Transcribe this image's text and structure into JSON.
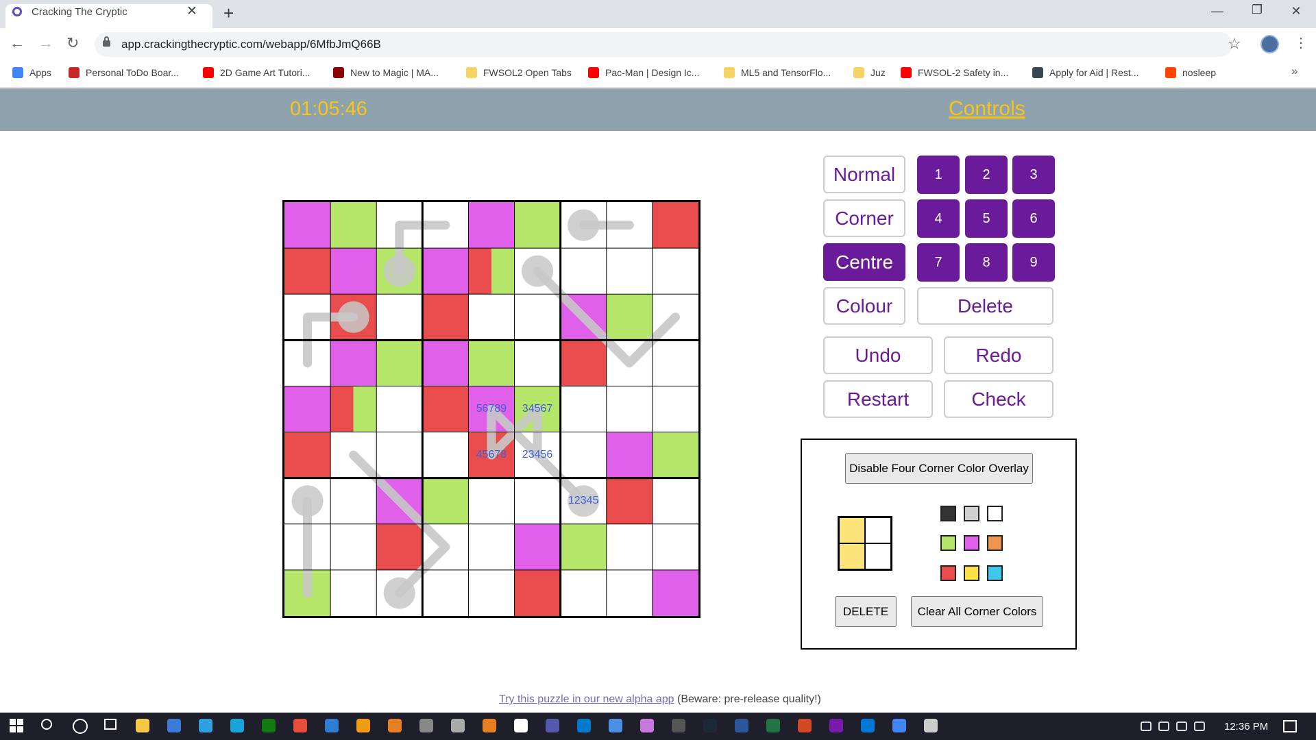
{
  "browser": {
    "tab_title": "Cracking The Cryptic",
    "url": "app.crackingthecryptic.com/webapp/6MfbJmQ66B",
    "bookmarks": [
      {
        "label": "Apps",
        "color": "#4285f4"
      },
      {
        "label": "Personal ToDo Boar...",
        "color": "#c62828"
      },
      {
        "label": "2D Game Art Tutori...",
        "color": "#ff0000"
      },
      {
        "label": "New to Magic | MA...",
        "color": "#8b0000"
      },
      {
        "label": "FWSOL2 Open Tabs",
        "color": "#f6d365"
      },
      {
        "label": "Pac-Man | Design Ic...",
        "color": "#ff0000"
      },
      {
        "label": "ML5 and TensorFlo...",
        "color": "#f6d365"
      },
      {
        "label": "Juz",
        "color": "#f6d365"
      },
      {
        "label": "FWSOL-2 Safety in...",
        "color": "#ff0000"
      },
      {
        "label": "Apply for Aid | Rest...",
        "color": "#37474f"
      },
      {
        "label": "nosleep",
        "color": "#ff4500"
      }
    ],
    "more_bookmarks": "»"
  },
  "app": {
    "timer": "01:05:46",
    "controls_link": "Controls"
  },
  "modes": {
    "normal": "Normal",
    "corner": "Corner",
    "centre": "Centre",
    "colour": "Colour",
    "active": "Centre"
  },
  "digits": [
    "1",
    "2",
    "3",
    "4",
    "5",
    "6",
    "7",
    "8",
    "9"
  ],
  "actions": {
    "delete": "Delete",
    "undo": "Undo",
    "redo": "Redo",
    "restart": "Restart",
    "check": "Check"
  },
  "corner_panel": {
    "disable_button": "Disable Four Corner Color Overlay",
    "delete_button": "DELETE",
    "clear_button": "Clear All Corner Colors",
    "preview_colors": [
      "#fde47a",
      "#ffffff",
      "#fde47a",
      "#ffffff"
    ],
    "palette": [
      "#333333",
      "#d0d0d0",
      "#ffffff",
      "#b5e66a",
      "#e060ea",
      "#f0954d",
      "#e84c4c",
      "#fde047",
      "#3ec9ec"
    ]
  },
  "grid": {
    "colors": {
      "M": "#e060ea",
      "G": "#b5e66a",
      "R": "#e84c4c",
      "W": "#ffffff"
    },
    "cells": [
      [
        "M",
        "G",
        "W",
        "W",
        "M",
        "G",
        "W",
        "W",
        "R"
      ],
      [
        "R",
        "M",
        "G",
        "M",
        "R|G",
        "W",
        "W",
        "W",
        "W"
      ],
      [
        "W",
        "R",
        "W",
        "R",
        "W",
        "W",
        "M",
        "G",
        "W"
      ],
      [
        "W",
        "M",
        "G",
        "M",
        "G",
        "W",
        "R",
        "W",
        "W"
      ],
      [
        "M",
        "R|G",
        "W",
        "R",
        "M",
        "G",
        "W",
        "W",
        "W"
      ],
      [
        "R",
        "W",
        "W",
        "W",
        "R",
        "W",
        "W",
        "M",
        "G"
      ],
      [
        "W",
        "W",
        "M",
        "G",
        "W",
        "W",
        "W",
        "R",
        "W"
      ],
      [
        "W",
        "W",
        "R",
        "W",
        "W",
        "M",
        "G",
        "W",
        "W"
      ],
      [
        "G",
        "W",
        "W",
        "W",
        "W",
        "R",
        "W",
        "W",
        "M"
      ]
    ],
    "pencil_marks": [
      {
        "row": 4,
        "col": 4,
        "text": "56789"
      },
      {
        "row": 4,
        "col": 5,
        "text": "34567"
      },
      {
        "row": 5,
        "col": 4,
        "text": "45678"
      },
      {
        "row": 5,
        "col": 5,
        "text": "23456"
      },
      {
        "row": 6,
        "col": 6,
        "text": "12345"
      }
    ]
  },
  "footer": {
    "link": "Try this puzzle in our new alpha app",
    "note": " (Beware: pre-release quality!)"
  },
  "taskbar": {
    "clock": "12:36 PM"
  }
}
